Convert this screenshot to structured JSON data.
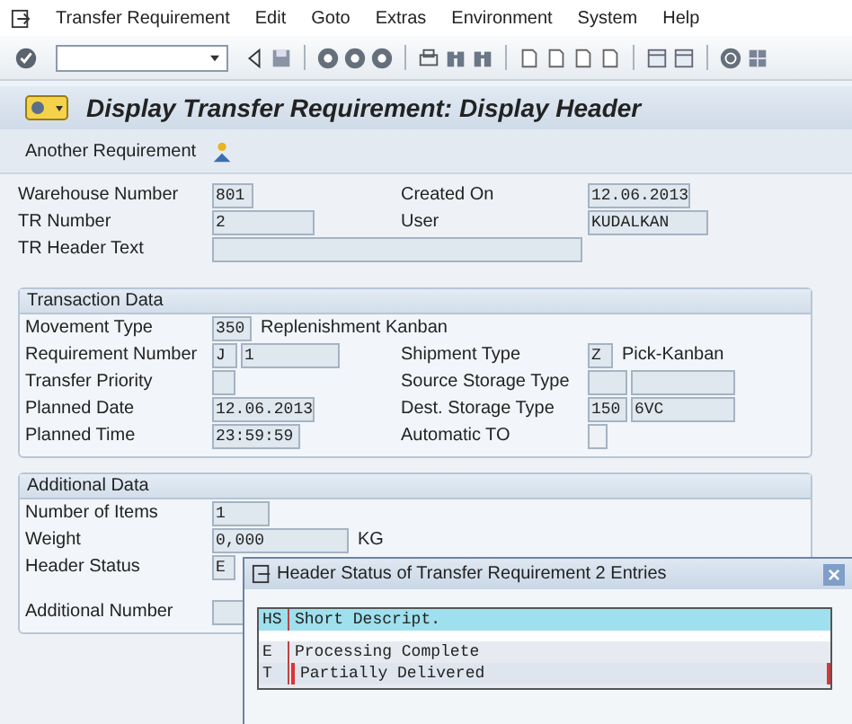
{
  "menu": [
    "Transfer Requirement",
    "Edit",
    "Goto",
    "Extras",
    "Environment",
    "System",
    "Help"
  ],
  "title": "Display Transfer Requirement: Display Header",
  "app_toolbar": {
    "button": "Another Requirement"
  },
  "sections": [
    {
      "rows": [
        {
          "label": "Warehouse Number",
          "fields": [
            {
              "kind": "input",
              "value": "801"
            }
          ],
          "right": {
            "label": "Created On",
            "fields": [
              {
                "kind": "input",
                "value": "12.06.2013"
              }
            ]
          }
        },
        {
          "label": "TR Number",
          "fields": [
            {
              "kind": "input",
              "value": "2"
            }
          ],
          "right": {
            "label": "User",
            "fields": [
              {
                "kind": "input",
                "value": "KUDALKAN"
              }
            ]
          }
        },
        {
          "label": "TR Header Text",
          "fields": [
            {
              "kind": "input"
            }
          ]
        }
      ]
    },
    {
      "title": "Transaction Data",
      "rows": [
        {
          "label": "Movement Type",
          "fields": [
            {
              "kind": "input",
              "value": "350"
            },
            {
              "kind": "text",
              "value": "Replenishment Kanban"
            }
          ]
        },
        {
          "label": "Requirement Number",
          "fields": [
            {
              "kind": "input",
              "value": "J"
            },
            {
              "kind": "input",
              "value": "1"
            }
          ],
          "right": {
            "label": "Shipment Type",
            "fields": [
              {
                "kind": "input",
                "value": "Z"
              },
              {
                "kind": "text",
                "value": "Pick-Kanban"
              }
            ]
          }
        },
        {
          "label": "Transfer Priority",
          "fields": [
            {
              "kind": "input"
            }
          ],
          "right": {
            "label": "Source Storage Type",
            "fields": [
              {
                "kind": "input"
              },
              {
                "kind": "input"
              }
            ]
          }
        },
        {
          "label": "Planned Date",
          "fields": [
            {
              "kind": "input",
              "value": "12.06.2013"
            }
          ],
          "right": {
            "label": "Dest. Storage Type",
            "fields": [
              {
                "kind": "input",
                "value": "150"
              },
              {
                "kind": "input",
                "value": "6VC"
              }
            ]
          }
        },
        {
          "label": "Planned Time",
          "fields": [
            {
              "kind": "input",
              "value": "23:59:59"
            }
          ],
          "right": {
            "label": "Automatic TO",
            "fields": [
              {
                "kind": "checkbox",
                "checked": false
              }
            ]
          }
        }
      ]
    },
    {
      "title": "Additional Data",
      "rows": [
        {
          "label": "Number of Items",
          "fields": [
            {
              "kind": "input",
              "value": "1"
            }
          ]
        },
        {
          "label": "Weight",
          "fields": [
            {
              "kind": "input",
              "value": "0,000"
            },
            {
              "kind": "text",
              "value": "KG"
            }
          ]
        },
        {
          "label": "Header Status",
          "fields": [
            {
              "kind": "input",
              "value": "E"
            }
          ]
        },
        {
          "label": "Additional Number",
          "fields": [
            {
              "kind": "input"
            }
          ]
        }
      ]
    }
  ],
  "popup": {
    "title": "Header Status of Transfer Requirement 2 Entries",
    "columns": [
      "HS",
      "Short Descript."
    ],
    "rows": [
      {
        "code": "E",
        "text": "Processing Complete",
        "selected": false
      },
      {
        "code": "T",
        "text": "Partially Delivered",
        "selected": true
      }
    ]
  }
}
